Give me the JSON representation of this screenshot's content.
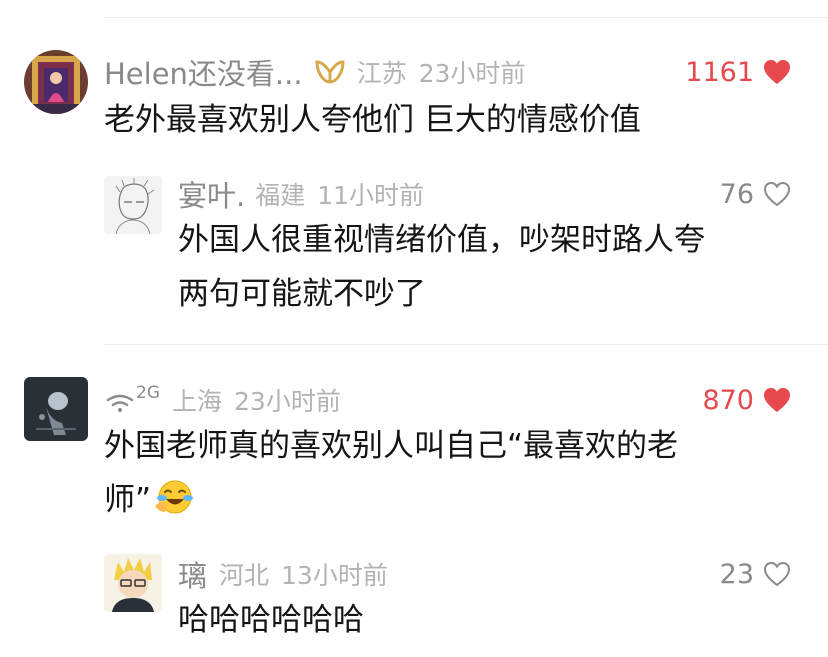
{
  "comments": [
    {
      "username": "Helen还没看...",
      "badge_icon": "vip-ribbon-icon",
      "location": "江苏",
      "time": "23小时前",
      "likes": "1161",
      "liked": true,
      "text": "老外最喜欢别人夸他们 巨大的情感价值",
      "reply": {
        "username": "宴叶.",
        "location": "福建",
        "time": "11小时前",
        "likes": "76",
        "liked": false,
        "text_line1": "外国人很重视情绪价值，吵架时路人夸",
        "text_line2": "两句可能就不吵了"
      }
    },
    {
      "username_icon": "wifi-2g-icon",
      "username_label": "2G",
      "location": "上海",
      "time": "23小时前",
      "likes": "870",
      "liked": true,
      "text_line1": "外国老师真的喜欢别人叫自己“最喜欢的老",
      "text_line2": "师”",
      "emoji": "laughing-crying-emoji",
      "reply": {
        "username": "璃",
        "location": "河北",
        "time": "13小时前",
        "likes": "23",
        "liked": false,
        "text": "哈哈哈哈哈哈"
      }
    }
  ],
  "colors": {
    "heart_red": "#e5484d",
    "meta_gray": "#b3b3b3",
    "name_gray": "#8a8a8a"
  }
}
